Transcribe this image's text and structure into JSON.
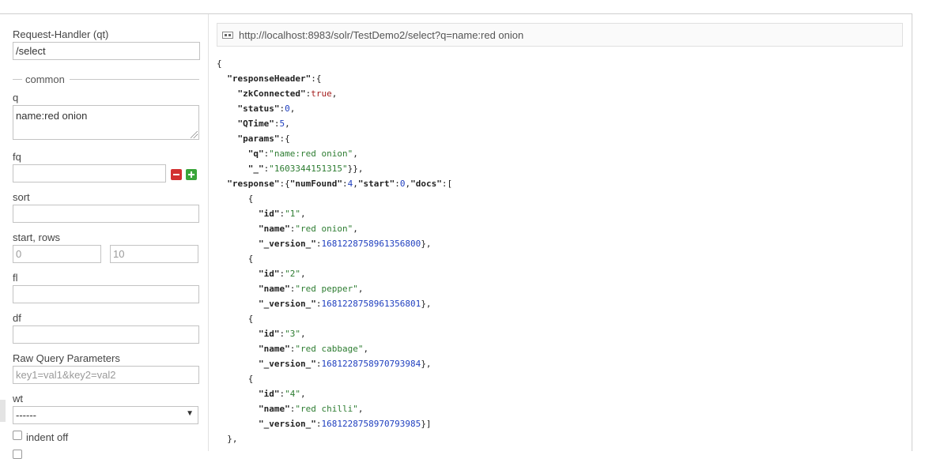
{
  "form": {
    "request_handler": {
      "label": "Request-Handler (qt)",
      "value": "/select"
    },
    "section_common": "common",
    "q": {
      "label": "q",
      "value": "name:red onion"
    },
    "fq": {
      "label": "fq",
      "value": ""
    },
    "sort": {
      "label": "sort",
      "value": ""
    },
    "start_rows": {
      "label": "start, rows",
      "start_placeholder": "0",
      "rows_placeholder": "10"
    },
    "fl": {
      "label": "fl",
      "value": ""
    },
    "df": {
      "label": "df",
      "value": ""
    },
    "raw": {
      "label": "Raw Query Parameters",
      "placeholder": "key1=val1&key2=val2"
    },
    "wt": {
      "label": "wt",
      "value": "------"
    },
    "indent": {
      "label": "indent off",
      "checked": false
    }
  },
  "result": {
    "url": "http://localhost:8983/solr/TestDemo2/select?q=name:red onion",
    "lines": [
      [
        {
          "t": "{",
          "c": "p"
        }
      ],
      [
        {
          "t": "  ",
          "c": "p"
        },
        {
          "t": "\"responseHeader\"",
          "c": "k"
        },
        {
          "t": ":{",
          "c": "p"
        }
      ],
      [
        {
          "t": "    ",
          "c": "p"
        },
        {
          "t": "\"zkConnected\"",
          "c": "k"
        },
        {
          "t": ":",
          "c": "p"
        },
        {
          "t": "true",
          "c": "bv"
        },
        {
          "t": ",",
          "c": "p"
        }
      ],
      [
        {
          "t": "    ",
          "c": "p"
        },
        {
          "t": "\"status\"",
          "c": "k"
        },
        {
          "t": ":",
          "c": "p"
        },
        {
          "t": "0",
          "c": "nv"
        },
        {
          "t": ",",
          "c": "p"
        }
      ],
      [
        {
          "t": "    ",
          "c": "p"
        },
        {
          "t": "\"QTime\"",
          "c": "k"
        },
        {
          "t": ":",
          "c": "p"
        },
        {
          "t": "5",
          "c": "nv"
        },
        {
          "t": ",",
          "c": "p"
        }
      ],
      [
        {
          "t": "    ",
          "c": "p"
        },
        {
          "t": "\"params\"",
          "c": "k"
        },
        {
          "t": ":{",
          "c": "p"
        }
      ],
      [
        {
          "t": "      ",
          "c": "p"
        },
        {
          "t": "\"q\"",
          "c": "k"
        },
        {
          "t": ":",
          "c": "p"
        },
        {
          "t": "\"name:red onion\"",
          "c": "sv"
        },
        {
          "t": ",",
          "c": "p"
        }
      ],
      [
        {
          "t": "      ",
          "c": "p"
        },
        {
          "t": "\"_\"",
          "c": "k"
        },
        {
          "t": ":",
          "c": "p"
        },
        {
          "t": "\"1603344151315\"",
          "c": "sv"
        },
        {
          "t": "}},",
          "c": "p"
        }
      ],
      [
        {
          "t": "  ",
          "c": "p"
        },
        {
          "t": "\"response\"",
          "c": "k"
        },
        {
          "t": ":{",
          "c": "p"
        },
        {
          "t": "\"numFound\"",
          "c": "k"
        },
        {
          "t": ":",
          "c": "p"
        },
        {
          "t": "4",
          "c": "nv"
        },
        {
          "t": ",",
          "c": "p"
        },
        {
          "t": "\"start\"",
          "c": "k"
        },
        {
          "t": ":",
          "c": "p"
        },
        {
          "t": "0",
          "c": "nv"
        },
        {
          "t": ",",
          "c": "p"
        },
        {
          "t": "\"docs\"",
          "c": "k"
        },
        {
          "t": ":[",
          "c": "p"
        }
      ],
      [
        {
          "t": "      {",
          "c": "p"
        }
      ],
      [
        {
          "t": "        ",
          "c": "p"
        },
        {
          "t": "\"id\"",
          "c": "k"
        },
        {
          "t": ":",
          "c": "p"
        },
        {
          "t": "\"1\"",
          "c": "sv"
        },
        {
          "t": ",",
          "c": "p"
        }
      ],
      [
        {
          "t": "        ",
          "c": "p"
        },
        {
          "t": "\"name\"",
          "c": "k"
        },
        {
          "t": ":",
          "c": "p"
        },
        {
          "t": "\"red onion\"",
          "c": "sv"
        },
        {
          "t": ",",
          "c": "p"
        }
      ],
      [
        {
          "t": "        ",
          "c": "p"
        },
        {
          "t": "\"_version_\"",
          "c": "k"
        },
        {
          "t": ":",
          "c": "p"
        },
        {
          "t": "1681228758961356800",
          "c": "nv"
        },
        {
          "t": "},",
          "c": "p"
        }
      ],
      [
        {
          "t": "      {",
          "c": "p"
        }
      ],
      [
        {
          "t": "        ",
          "c": "p"
        },
        {
          "t": "\"id\"",
          "c": "k"
        },
        {
          "t": ":",
          "c": "p"
        },
        {
          "t": "\"2\"",
          "c": "sv"
        },
        {
          "t": ",",
          "c": "p"
        }
      ],
      [
        {
          "t": "        ",
          "c": "p"
        },
        {
          "t": "\"name\"",
          "c": "k"
        },
        {
          "t": ":",
          "c": "p"
        },
        {
          "t": "\"red pepper\"",
          "c": "sv"
        },
        {
          "t": ",",
          "c": "p"
        }
      ],
      [
        {
          "t": "        ",
          "c": "p"
        },
        {
          "t": "\"_version_\"",
          "c": "k"
        },
        {
          "t": ":",
          "c": "p"
        },
        {
          "t": "1681228758961356801",
          "c": "nv"
        },
        {
          "t": "},",
          "c": "p"
        }
      ],
      [
        {
          "t": "      {",
          "c": "p"
        }
      ],
      [
        {
          "t": "        ",
          "c": "p"
        },
        {
          "t": "\"id\"",
          "c": "k"
        },
        {
          "t": ":",
          "c": "p"
        },
        {
          "t": "\"3\"",
          "c": "sv"
        },
        {
          "t": ",",
          "c": "p"
        }
      ],
      [
        {
          "t": "        ",
          "c": "p"
        },
        {
          "t": "\"name\"",
          "c": "k"
        },
        {
          "t": ":",
          "c": "p"
        },
        {
          "t": "\"red cabbage\"",
          "c": "sv"
        },
        {
          "t": ",",
          "c": "p"
        }
      ],
      [
        {
          "t": "        ",
          "c": "p"
        },
        {
          "t": "\"_version_\"",
          "c": "k"
        },
        {
          "t": ":",
          "c": "p"
        },
        {
          "t": "1681228758970793984",
          "c": "nv"
        },
        {
          "t": "},",
          "c": "p"
        }
      ],
      [
        {
          "t": "      {",
          "c": "p"
        }
      ],
      [
        {
          "t": "        ",
          "c": "p"
        },
        {
          "t": "\"id\"",
          "c": "k"
        },
        {
          "t": ":",
          "c": "p"
        },
        {
          "t": "\"4\"",
          "c": "sv"
        },
        {
          "t": ",",
          "c": "p"
        }
      ],
      [
        {
          "t": "        ",
          "c": "p"
        },
        {
          "t": "\"name\"",
          "c": "k"
        },
        {
          "t": ":",
          "c": "p"
        },
        {
          "t": "\"red chilli\"",
          "c": "sv"
        },
        {
          "t": ",",
          "c": "p"
        }
      ],
      [
        {
          "t": "        ",
          "c": "p"
        },
        {
          "t": "\"_version_\"",
          "c": "k"
        },
        {
          "t": ":",
          "c": "p"
        },
        {
          "t": "1681228758970793985",
          "c": "nv"
        },
        {
          "t": "}]",
          "c": "p"
        }
      ],
      [
        {
          "t": "  },",
          "c": "p"
        }
      ]
    ]
  },
  "colors": {
    "key": "#222222",
    "string": "#2e7d32",
    "number": "#1f3fbf",
    "boolean": "#a41c1c",
    "remove": "#d23030",
    "add": "#3aa53a"
  },
  "icons": {
    "url_icon": "link-icon",
    "remove_fq": "minus-icon",
    "add_fq": "plus-icon",
    "select_arrow": "triangle-down-icon"
  }
}
